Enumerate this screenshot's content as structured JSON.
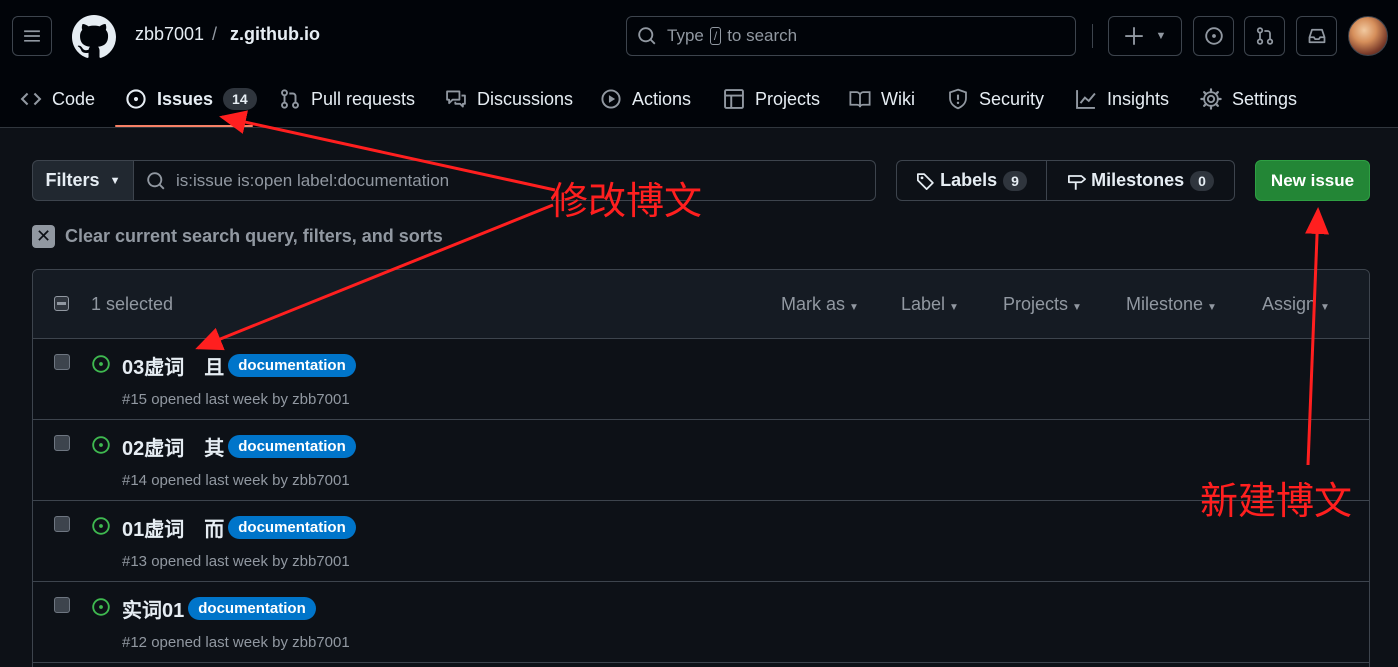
{
  "header": {
    "owner": "zbb7001",
    "separator": "/",
    "repo": "z.github.io",
    "search_prefix": "Type",
    "search_key": "/",
    "search_suffix": "to search"
  },
  "nav": {
    "code": "Code",
    "issues": "Issues",
    "issues_count": "14",
    "pull_requests": "Pull requests",
    "discussions": "Discussions",
    "actions": "Actions",
    "projects": "Projects",
    "wiki": "Wiki",
    "security": "Security",
    "insights": "Insights",
    "settings": "Settings"
  },
  "toolbar": {
    "filters_label": "Filters",
    "query": "is:issue is:open label:documentation",
    "labels_label": "Labels",
    "labels_count": "9",
    "milestones_label": "Milestones",
    "milestones_count": "0",
    "new_issue_label": "New issue",
    "clear_text": "Clear current search query, filters, and sorts"
  },
  "list_header": {
    "selected": "1 selected",
    "mark_as": "Mark as",
    "label": "Label",
    "projects": "Projects",
    "milestone": "Milestone",
    "assign": "Assign"
  },
  "issues": [
    {
      "title": "03虚词　且",
      "label": "documentation",
      "meta": "#15 opened last week by zbb7001"
    },
    {
      "title": "02虚词　其",
      "label": "documentation",
      "meta": "#14 opened last week by zbb7001"
    },
    {
      "title": "01虚词　而",
      "label": "documentation",
      "meta": "#13 opened last week by zbb7001"
    },
    {
      "title": "实词01",
      "label": "documentation",
      "meta": "#12 opened last week by zbb7001"
    }
  ],
  "annotations": {
    "edit_post": "修改博文",
    "new_post": "新建博文"
  },
  "colors": {
    "label_documentation": "#0075ca",
    "new_issue_button": "#238636",
    "open_issue_icon": "#3fb950",
    "annotation": "#ff1f1f"
  }
}
